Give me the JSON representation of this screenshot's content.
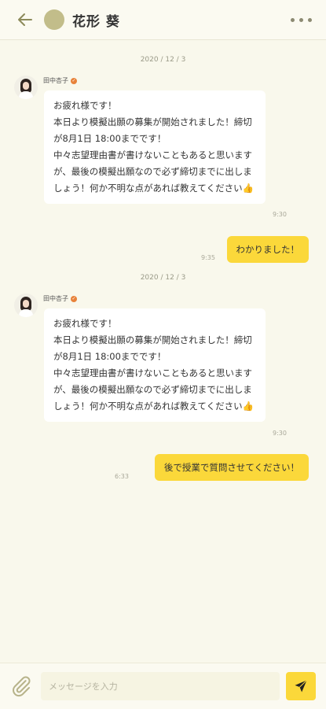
{
  "header": {
    "title": "花形 葵",
    "back_icon": "arrow-left-icon",
    "more_icon": "more-horizontal-icon",
    "avatar_color": "#c2bd8a"
  },
  "messages": [
    {
      "date": "2020 / 12 / 3",
      "sender": "田中杏子",
      "incoming_text": "お疲れ様です！\n本日より模擬出願の募集が開始されました！締切が8月1日 18:00までです！\n中々志望理由書が書けないこともあると思いますが、最後の模擬出願なので必ず締切までに出しましょう！何か不明な点があれば教えてください👍",
      "incoming_time": "9:30",
      "outgoing_text": "わかりました！",
      "outgoing_time": "9:35"
    },
    {
      "date": "2020 / 12 / 3",
      "sender": "田中杏子",
      "incoming_text": "お疲れ様です！\n本日より模擬出願の募集が開始されました！締切が8月1日 18:00までです！\n中々志望理由書が書けないこともあると思いますが、最後の模擬出願なので必ず締切までに出しましょう！何か不明な点があれば教えてください👍",
      "incoming_time": "9:30",
      "outgoing_text": "後で授業で質問させてください！",
      "outgoing_time": "6:33"
    }
  ],
  "composer": {
    "placeholder": "メッセージを入力",
    "attach_icon": "paperclip-icon",
    "send_icon": "paper-plane-icon"
  },
  "colors": {
    "background": "#f9f8ec",
    "accent": "#fbd83a",
    "verified": "#e8823a"
  }
}
